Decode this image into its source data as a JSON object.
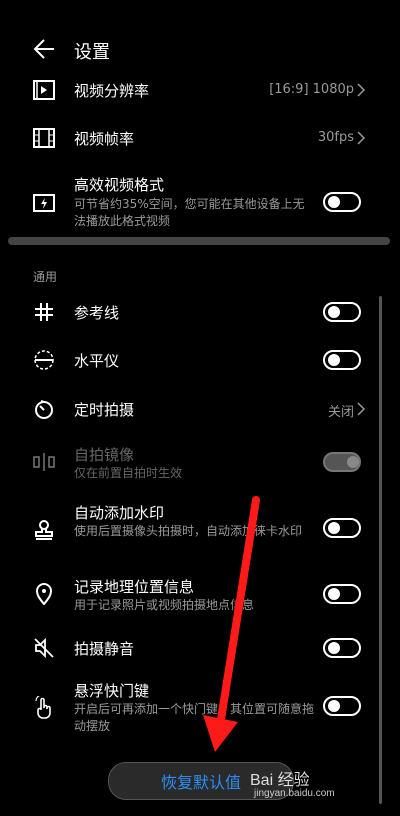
{
  "header": {
    "title": "设置"
  },
  "rows": [
    {
      "label": "视频分辨率",
      "value": "[16:9] 1080p"
    },
    {
      "label": "视频帧率",
      "value": "30fps"
    },
    {
      "label": "高效视频格式",
      "sub": "可节省约35%空间，您可能在其他设备上无法播放此格式视频"
    }
  ],
  "section_label": "通用",
  "general": [
    {
      "label": "参考线"
    },
    {
      "label": "水平仪"
    },
    {
      "label": "定时拍摄",
      "value": "关闭"
    },
    {
      "label": "自拍镜像",
      "sub": "仅在前置自拍时生效"
    },
    {
      "label": "自动添加水印",
      "sub": "使用后置摄像头拍摄时，自动添加徕卡水印"
    },
    {
      "label": "记录地理位置信息",
      "sub": "用于记录照片或视频拍摄地点信息"
    },
    {
      "label": "拍摄静音"
    },
    {
      "label": "悬浮快门键",
      "sub": "开启后可再添加一个快门键，其位置可随意拖动摆放"
    }
  ],
  "reset_button": "恢复默认值",
  "watermark": {
    "brand": "Bai 经验",
    "url": "jingyan.baidu.com"
  },
  "colors": {
    "accent": "#2a8ef5",
    "arrow": "#ff1a1a"
  }
}
